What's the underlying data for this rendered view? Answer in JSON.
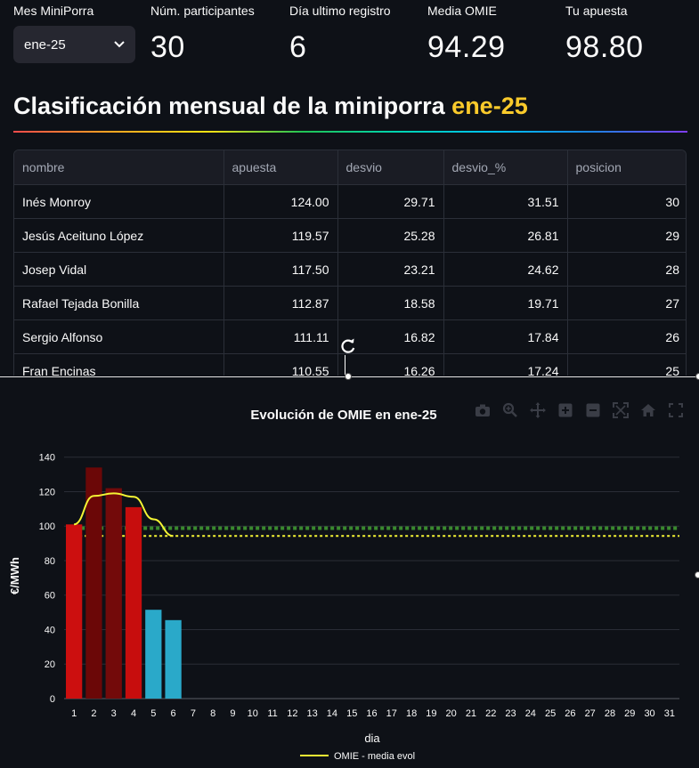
{
  "metrics": {
    "month_label": "Mes MiniPorra",
    "month_value": "ene-25",
    "participants_label": "Núm. participantes",
    "participants_value": "30",
    "lastday_label": "Día ultimo registro",
    "lastday_value": "6",
    "omie_label": "Media OMIE",
    "omie_value": "94.29",
    "bet_label": "Tu apuesta",
    "bet_value": "98.80"
  },
  "heading": {
    "text": "Clasificación mensual de la miniporra ",
    "accent": "ene-25"
  },
  "table": {
    "columns": [
      "nombre",
      "apuesta",
      "desvio",
      "desvio_%",
      "posicion"
    ],
    "rows": [
      [
        "Inés Monroy",
        "124.00",
        "29.71",
        "31.51",
        "30"
      ],
      [
        "Jesús Aceituno López",
        "119.57",
        "25.28",
        "26.81",
        "29"
      ],
      [
        "Josep Vidal",
        "117.50",
        "23.21",
        "24.62",
        "28"
      ],
      [
        "Rafael Tejada Bonilla",
        "112.87",
        "18.58",
        "19.71",
        "27"
      ],
      [
        "Sergio Alfonso",
        "111.11",
        "16.82",
        "17.84",
        "26"
      ],
      [
        "Fran Encinas",
        "110.55",
        "16.26",
        "17.24",
        "25"
      ]
    ]
  },
  "modebar": {
    "icons": [
      "camera-icon",
      "zoom-icon",
      "pan-icon",
      "zoom-in-icon",
      "zoom-out-icon",
      "autoscale-icon",
      "reset-axes-icon",
      "fullscreen-icon"
    ]
  },
  "chart_data": {
    "type": "bar",
    "title": "Evolución de OMIE en ene-25",
    "xlabel": "dia",
    "ylabel": "€/MWh",
    "x": [
      1,
      2,
      3,
      4,
      5,
      6,
      7,
      8,
      9,
      10,
      11,
      12,
      13,
      14,
      15,
      16,
      17,
      18,
      19,
      20,
      21,
      22,
      23,
      24,
      25,
      26,
      27,
      28,
      29,
      30,
      31
    ],
    "ylim": [
      0,
      145
    ],
    "yticks": [
      0,
      20,
      40,
      60,
      80,
      100,
      120,
      140
    ],
    "grid": true,
    "bars": {
      "values": [
        101,
        134,
        122,
        111,
        51.5,
        45.5
      ],
      "colors": [
        "#cc0f0f",
        "#6b0707",
        "#730a0a",
        "#c70d0d",
        "#2aa9c9",
        "#2aa9c9"
      ]
    },
    "series": [
      {
        "name": "OMIE - media evol",
        "type": "line",
        "color": "#f5f534",
        "x": [
          1,
          2,
          3,
          4,
          5,
          6
        ],
        "values": [
          101,
          117.5,
          119,
          117,
          104,
          94.29
        ]
      }
    ],
    "reference_lines": [
      {
        "value": 94.29,
        "color": "#f5f534",
        "style": "dotted"
      },
      {
        "value": 98.8,
        "color": "#3a8a2e",
        "style": "dotted"
      }
    ],
    "legend": {
      "placement": "bottom-center"
    }
  }
}
